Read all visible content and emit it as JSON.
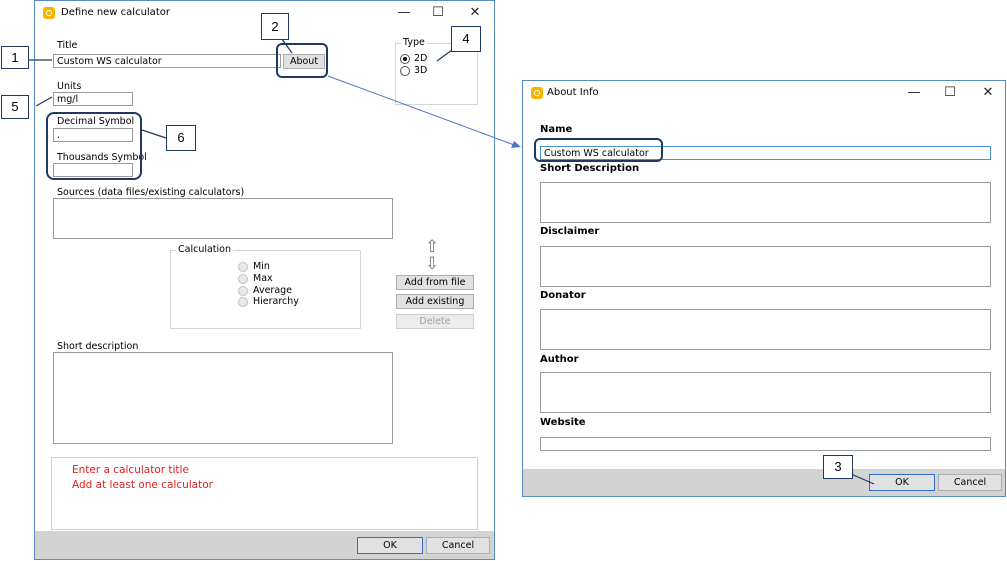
{
  "main_window": {
    "title": "Define new calculator",
    "title_label": "Title",
    "title_value": "Custom WS calculator",
    "about_button": "About",
    "type_label": "Type",
    "type_options": [
      "2D",
      "3D"
    ],
    "type_selected": "2D",
    "units_label": "Units",
    "units_value": "mg/l",
    "decimal_label": "Decimal Symbol",
    "decimal_value": ".",
    "thousands_label": "Thousands Symbol",
    "thousands_value": "",
    "sources_label": "Sources (data files/existing calculators)",
    "calculation_label": "Calculation",
    "calculation_options": [
      "Min",
      "Max",
      "Average",
      "Hierarchy"
    ],
    "up_arrow": "⇧",
    "down_arrow": "⇩",
    "add_from_file": "Add from file",
    "add_existing": "Add existing",
    "delete": "Delete",
    "short_description_label": "Short description",
    "errors": [
      "Enter a calculator title",
      "Add at least one calculator"
    ],
    "ok": "OK",
    "cancel": "Cancel"
  },
  "about_window": {
    "title": "About Info",
    "name_label": "Name",
    "name_value": "Custom WS calculator",
    "short_description_label": "Short Description",
    "disclaimer_label": "Disclaimer",
    "donator_label": "Donator",
    "author_label": "Author",
    "website_label": "Website",
    "ok": "OK",
    "cancel": "Cancel"
  },
  "window_controls": {
    "minimize": "—",
    "maximize": "☐",
    "close": "✕"
  },
  "callouts": [
    "1",
    "2",
    "3",
    "4",
    "5",
    "6"
  ],
  "colors": {
    "accent_border": "#1f3a5f",
    "error": "#e02020",
    "footer": "#d3d3d3",
    "window_border": "#5b8bc4"
  }
}
